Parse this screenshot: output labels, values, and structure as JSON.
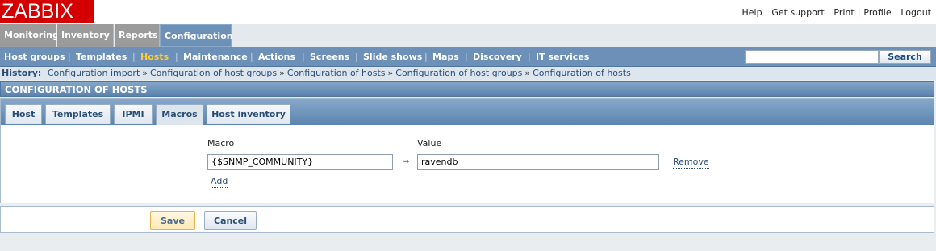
{
  "app": {
    "logo": "ZABBIX"
  },
  "top_links": [
    "Help",
    "Get support",
    "Print",
    "Profile",
    "Logout"
  ],
  "main_menu": [
    "Monitoring",
    "Inventory",
    "Reports",
    "Configuration"
  ],
  "main_menu_selected": "Configuration",
  "sub_menu": [
    "Host groups",
    "Templates",
    "Hosts",
    "Maintenance",
    "Actions",
    "Screens",
    "Slide shows",
    "Maps",
    "Discovery",
    "IT services"
  ],
  "sub_menu_active": "Hosts",
  "search": {
    "value": "",
    "button_label": "Search"
  },
  "history": {
    "label": "History:",
    "items": [
      "Configuration import",
      "Configuration of host groups",
      "Configuration of hosts",
      "Configuration of host groups",
      "Configuration of hosts"
    ]
  },
  "page_title": "CONFIGURATION OF HOSTS",
  "form_tabs": [
    "Host",
    "Templates",
    "IPMI",
    "Macros",
    "Host inventory"
  ],
  "form_tab_selected": "Macros",
  "macros": {
    "macro_header": "Macro",
    "value_header": "Value",
    "rows": [
      {
        "macro": "{$SNMP_COMMUNITY}",
        "value": "ravendb",
        "remove_label": "Remove"
      }
    ],
    "add_label": "Add"
  },
  "actions": {
    "save_label": "Save",
    "cancel_label": "Cancel"
  },
  "colors": {
    "logo_bg": "#d40000",
    "menu_selected": "#6d90b6",
    "submenu_bg": "#6c90b8",
    "submenu_active": "#ffcc33"
  }
}
